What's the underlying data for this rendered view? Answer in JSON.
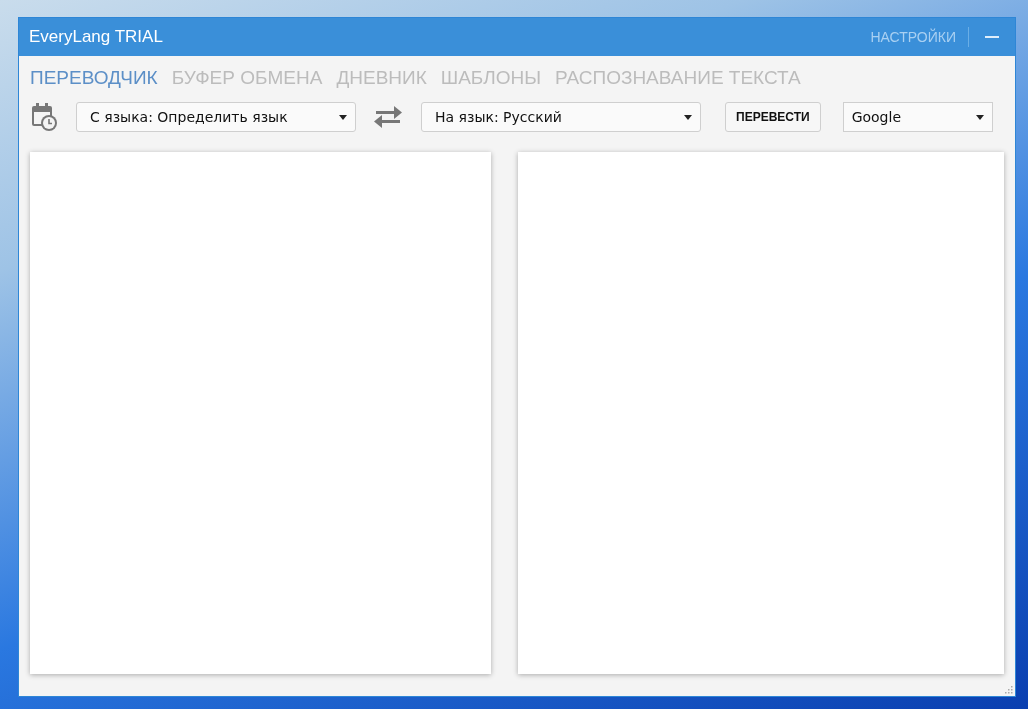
{
  "window": {
    "title": "EveryLang TRIAL",
    "settings_link": "НАСТРОЙКИ"
  },
  "tabs": [
    {
      "label": "ПЕРЕВОДЧИК",
      "selected": true
    },
    {
      "label": "БУФЕР ОБМЕНА",
      "selected": false
    },
    {
      "label": "ДНЕВНИК",
      "selected": false
    },
    {
      "label": "ШАБЛОНЫ",
      "selected": false
    },
    {
      "label": "РАСПОЗНАВАНИЕ ТЕКСТА",
      "selected": false
    }
  ],
  "toolbar": {
    "source_language": "С языка: Определить язык",
    "target_language": "На язык: Русский",
    "translate_button": "ПЕРЕВЕСТИ",
    "service": "Google"
  }
}
